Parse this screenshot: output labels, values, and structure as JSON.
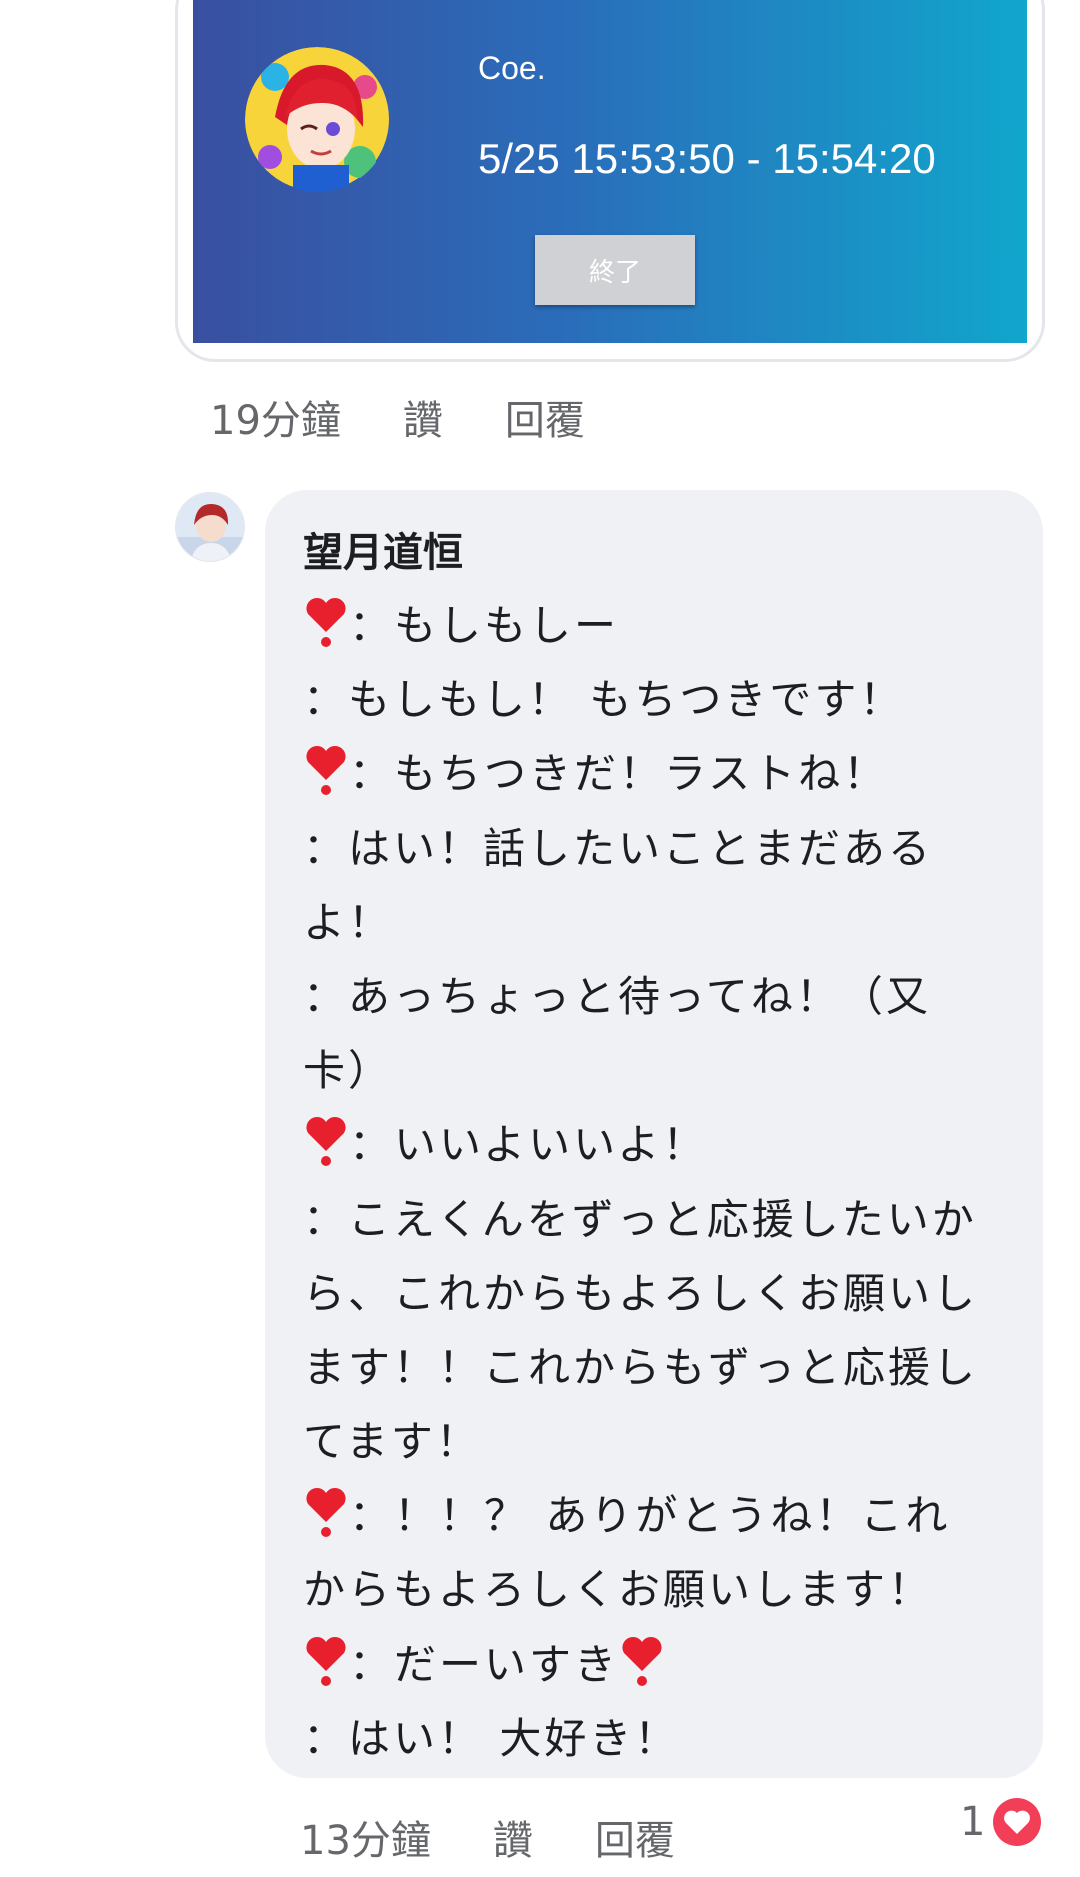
{
  "live_card": {
    "name": "Coe.",
    "time_range": "5/25 15:53:50 - 15:54:20",
    "end_button_label": "終了",
    "colors": {
      "gradient_start": "#3a4fa0",
      "gradient_end": "#11a6cc"
    }
  },
  "post_actions": {
    "time": "19分鐘",
    "like": "讚",
    "reply": "回覆"
  },
  "comment": {
    "author": "望月道恒",
    "lines": [
      {
        "heart": true,
        "text": "：もしもしー"
      },
      {
        "heart": false,
        "text": "：もしもし！ もちつきです！"
      },
      {
        "heart": true,
        "text": "：もちつきだ！ラストね！"
      },
      {
        "heart": false,
        "text": "：はい！話したいことまだある"
      },
      {
        "heart": false,
        "text": "よ！"
      },
      {
        "heart": false,
        "text": "：あっちょっと待ってね！（又"
      },
      {
        "heart": false,
        "text": "卡）"
      },
      {
        "heart": true,
        "text": "：いいよいいよ！"
      },
      {
        "heart": false,
        "text": "：こえくんをずっと応援したいか"
      },
      {
        "heart": false,
        "text": "ら、これからもよろしくお願いし"
      },
      {
        "heart": false,
        "text": "ます！！これからもずっと応援し"
      },
      {
        "heart": false,
        "text": "てます！"
      },
      {
        "heart": true,
        "text": "：！！？ ありがとうね！これ"
      },
      {
        "heart": false,
        "text": "からもよろしくお願いします！"
      },
      {
        "heart": true,
        "text": "：だーいすき",
        "trailing_heart": true
      },
      {
        "heart": false,
        "text": "：はい！ 大好き！"
      }
    ],
    "actions": {
      "time": "13分鐘",
      "like": "讚",
      "reply": "回覆"
    },
    "reaction_count": "1",
    "reaction_icon": "heart-reaction-icon",
    "colors": {
      "heart": "#e8202e",
      "reaction": "#f33e58"
    }
  }
}
